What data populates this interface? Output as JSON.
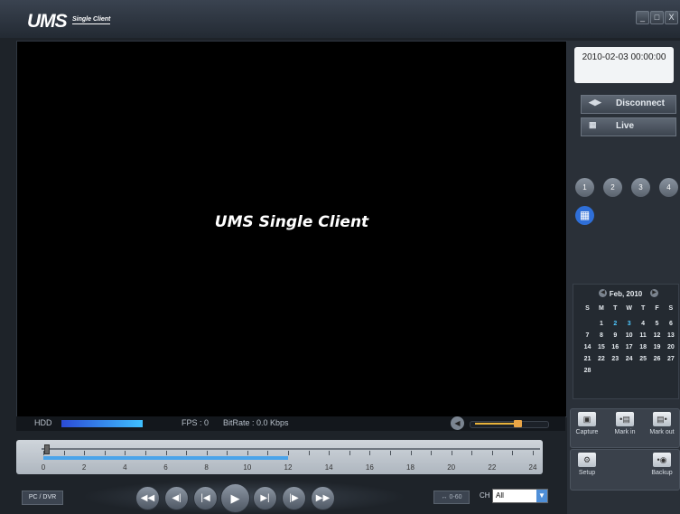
{
  "app": {
    "logo": "UMS",
    "subtitle": "Single Client"
  },
  "window_controls": {
    "minimize": "_",
    "maximize": "□",
    "close": "X"
  },
  "video": {
    "title": "UMS Single Client"
  },
  "status": {
    "hdd_label": "HDD",
    "fps": "FPS : 0",
    "bitrate": "BitRate : 0.0 Kbps",
    "hdd_level": 1.0,
    "volume_level": 0.6
  },
  "timeline": {
    "hours": [
      "0",
      "2",
      "4",
      "6",
      "8",
      "10",
      "12",
      "14",
      "16",
      "18",
      "20",
      "22",
      "24"
    ],
    "recorded_until_hour": 12
  },
  "controls": {
    "pc_dvr": "PC / DVR",
    "range": "0-60",
    "ch_label": "CH",
    "ch_value": "All",
    "buttons": [
      "fast-rewind",
      "step-back",
      "previous",
      "play",
      "next",
      "step-forward",
      "fast-forward"
    ]
  },
  "right_panel": {
    "datetime": "2010-02-03 00:00:00",
    "disconnect": "Disconnect",
    "live": "Live",
    "channels": [
      "1",
      "2",
      "3",
      "4"
    ]
  },
  "calendar": {
    "month": "Feb, 2010",
    "weekdays": [
      "S",
      "M",
      "T",
      "W",
      "T",
      "F",
      "S"
    ],
    "weeks": [
      [
        "",
        "1",
        "2",
        "3",
        "4",
        "5",
        "6"
      ],
      [
        "7",
        "8",
        "9",
        "10",
        "11",
        "12",
        "13"
      ],
      [
        "14",
        "15",
        "16",
        "17",
        "18",
        "19",
        "20"
      ],
      [
        "21",
        "22",
        "23",
        "24",
        "25",
        "26",
        "27"
      ],
      [
        "28",
        "",
        "",
        "",
        "",
        "",
        ""
      ]
    ],
    "highlighted": [
      "2",
      "3"
    ]
  },
  "tools": {
    "capture": "Capture",
    "mark_in": "Mark in",
    "mark_out": "Mark out",
    "setup": "Setup",
    "backup": "Backup"
  }
}
